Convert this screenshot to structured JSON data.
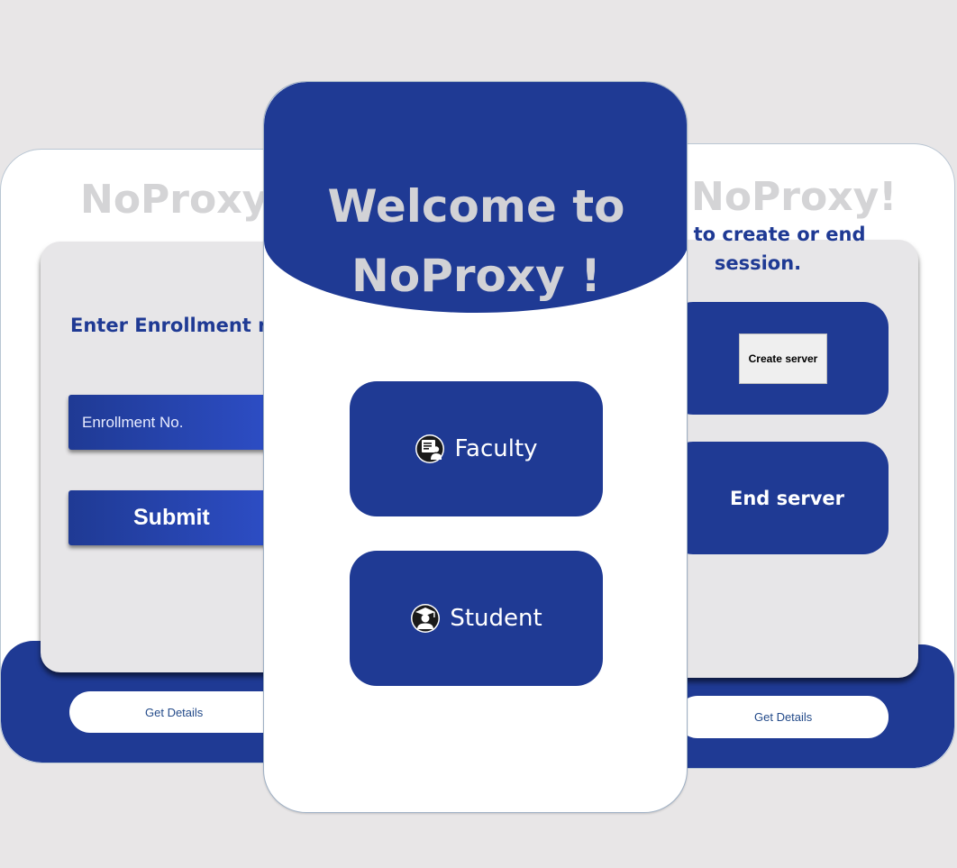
{
  "left_screen": {
    "brand": "NoProxy!",
    "prompt": "Enter Enrollment no",
    "enrollment_placeholder": "Enrollment No.",
    "submit_label": "Submit",
    "get_details_label": "Get Details"
  },
  "center_screen": {
    "title_line1": "Welcome to",
    "title_line2": "NoProxy !",
    "roles": [
      {
        "label": "Faculty",
        "icon": "faculty-board-icon"
      },
      {
        "label": "Student",
        "icon": "student-graduate-icon"
      }
    ]
  },
  "right_screen": {
    "brand": "NoProxy!",
    "prompt": "Tap to create or end session.",
    "create_server_label": "Create server",
    "end_server_label": "End server",
    "get_details_label": "Get Details"
  },
  "colors": {
    "primary_blue": "#1f3a94",
    "background": "#e8e6e7",
    "card_gray": "#e7e6e8",
    "brand_gray": "#d4d4d6"
  }
}
